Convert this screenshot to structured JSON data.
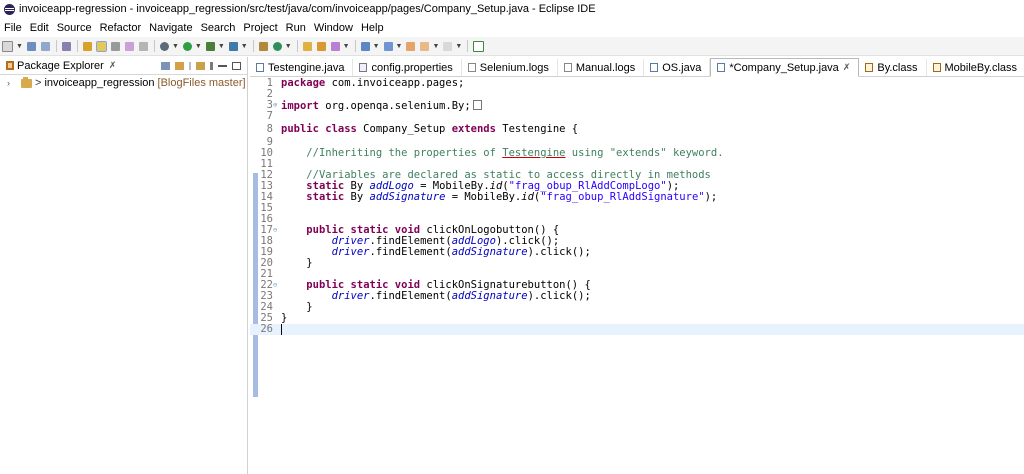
{
  "window": {
    "title": "invoiceapp-regression - invoiceapp_regression/src/test/java/com/invoiceapp/pages/Company_Setup.java - Eclipse IDE"
  },
  "menu": [
    "File",
    "Edit",
    "Source",
    "Refactor",
    "Navigate",
    "Search",
    "Project",
    "Run",
    "Window",
    "Help"
  ],
  "package_explorer": {
    "title": "Package Explorer",
    "close": "✗",
    "tree": [
      {
        "name": "invoiceapp_regression",
        "git": "[BlogFiles master]",
        "prefix": ">"
      }
    ]
  },
  "tabs": [
    {
      "label": "Testengine.java",
      "icon": "java-file-icon"
    },
    {
      "label": "config.properties",
      "icon": "properties-file-icon"
    },
    {
      "label": "Selenium.logs",
      "icon": "log-file-icon"
    },
    {
      "label": "Manual.logs",
      "icon": "log-file-icon"
    },
    {
      "label": "OS.java",
      "icon": "java-file-icon"
    },
    {
      "label": "*Company_Setup.java",
      "icon": "java-file-icon",
      "active": true,
      "close": "✗"
    },
    {
      "label": "By.class",
      "icon": "class-file-icon"
    },
    {
      "label": "MobileBy.class",
      "icon": "class-file-icon"
    }
  ],
  "code": {
    "line_numbers": [
      "1",
      "2",
      "3",
      "7",
      "8",
      "9",
      "10",
      "11",
      "12",
      "13",
      "14",
      "15",
      "16",
      "17",
      "18",
      "19",
      "20",
      "21",
      "22",
      "23",
      "24",
      "25",
      "26"
    ],
    "package_kw": "package",
    "package_name": " com.invoiceapp.pages;",
    "import_kw": "import",
    "import_name": " org.openqa.selenium.By;",
    "class_decl": {
      "kw1": "public class",
      "name": " Company_Setup ",
      "kw2": "extends",
      "parent": " Testengine {"
    },
    "comment1_a": "//Inheriting the properties of ",
    "comment1_b": "Testengine",
    "comment1_c": " using \"extends\" keyword.",
    "comment2": "//Variables are declared as static to access directly in methods",
    "field1": {
      "kw": "static",
      "type": " By ",
      "name": "addLogo",
      "eq": " = MobileBy.",
      "meth": "id",
      "open": "(",
      "str": "\"frag_obup_RlAddCompLogo\"",
      "close": ");"
    },
    "field2": {
      "kw": "static",
      "type": " By ",
      "name": "addSignature",
      "eq": " = MobileBy.",
      "meth": "id",
      "open": "(",
      "str": "\"frag_obup_RlAddSignature\"",
      "close": ");"
    },
    "method1": {
      "kw": "public static void",
      "sig": " clickOnLogobutton() {"
    },
    "m1_call1": {
      "drv": "driver",
      "a": ".findElement(",
      "f": "addLogo",
      "b": ").click();"
    },
    "m1_call2": {
      "drv": "driver",
      "a": ".findElement(",
      "f": "addSignature",
      "b": ").click();"
    },
    "close_brace": "}",
    "method2": {
      "kw": "public static void",
      "sig": " clickOnSignaturebutton() {"
    },
    "m2_call1": {
      "drv": "driver",
      "a": ".findElement(",
      "f": "addSignature",
      "b": ").click();"
    },
    "class_close": "}"
  },
  "colors": {
    "keyword": "#7f0055",
    "comment": "#3f7f5f",
    "string": "#2a00ff",
    "field": "#0000c0"
  }
}
